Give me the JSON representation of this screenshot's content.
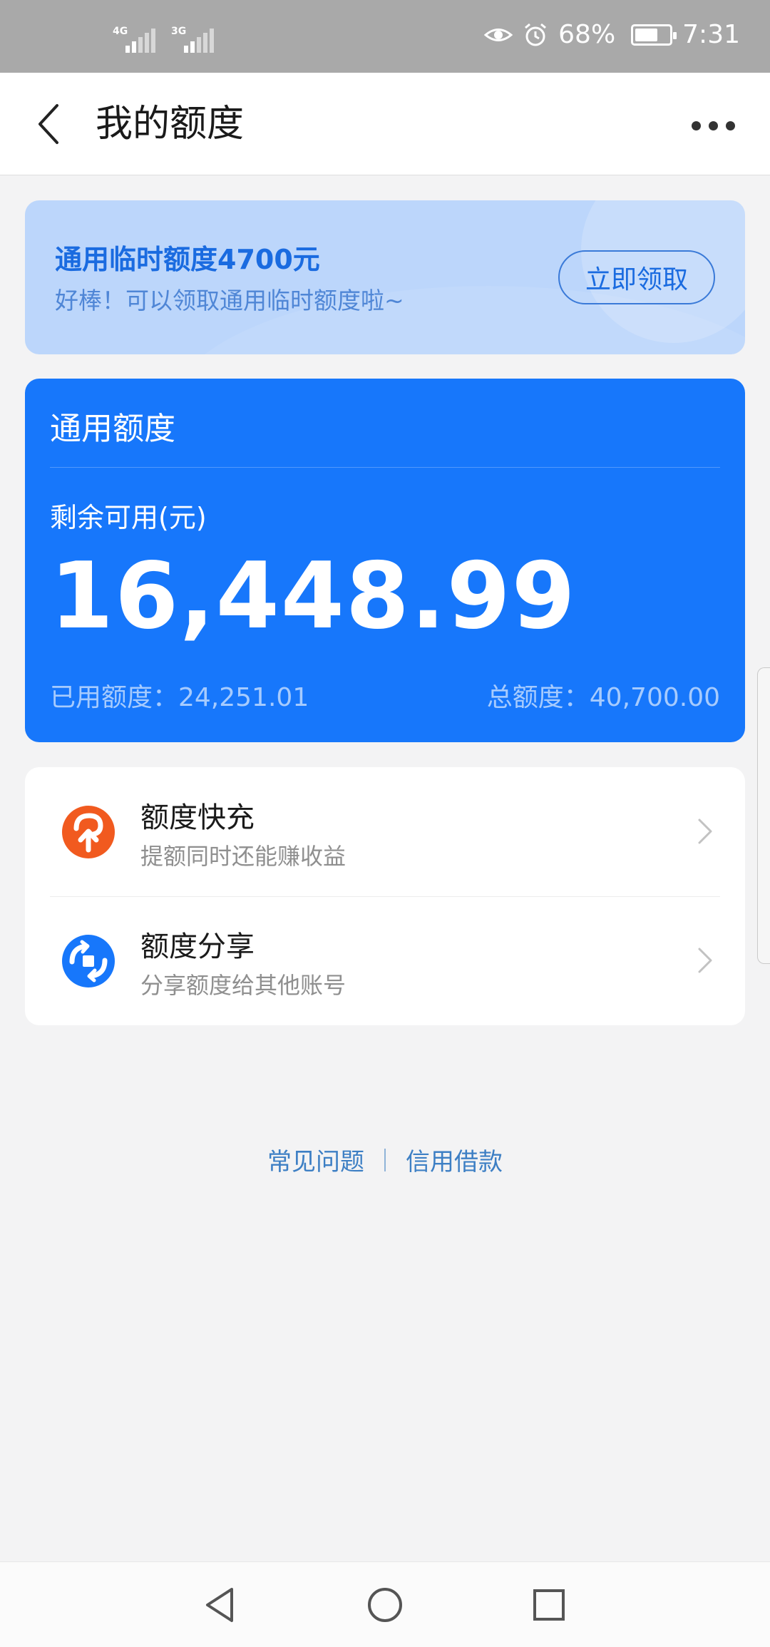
{
  "status_bar": {
    "signal_1_label": "4G",
    "signal_2_label": "3G",
    "battery_percent": "68%",
    "battery_level": 0.68,
    "time": "7:31",
    "icons": [
      "eye-icon",
      "alarm-icon",
      "battery-icon"
    ]
  },
  "header": {
    "title": "我的额度",
    "back_icon": "chevron-left-icon",
    "more_icon": "more-dots-icon"
  },
  "promo": {
    "title": "通用临时额度4700元",
    "subtitle": "好棒！可以领取通用临时额度啦~",
    "button_label": "立即领取"
  },
  "quota": {
    "title": "通用额度",
    "remaining_label": "剩余可用(元)",
    "remaining_amount": "16,448.99",
    "used_text": "已用额度：24,251.01",
    "total_text": "总额度：40,700.00"
  },
  "services": [
    {
      "title": "额度快充",
      "subtitle": "提额同时还能赚收益",
      "icon": "quota-boost-icon"
    },
    {
      "title": "额度分享",
      "subtitle": "分享额度给其他账号",
      "icon": "quota-share-icon"
    }
  ],
  "footer": {
    "faq_label": "常见问题",
    "credit_loan_label": "信用借款"
  },
  "colors": {
    "accent_blue": "#1777fb",
    "promo_bg": "#bcd6fb",
    "boost_orange": "#f15a1f",
    "link_blue": "#3d7fc4"
  },
  "nav": {
    "icons": [
      "nav-back-icon",
      "nav-home-icon",
      "nav-recent-icon"
    ]
  }
}
